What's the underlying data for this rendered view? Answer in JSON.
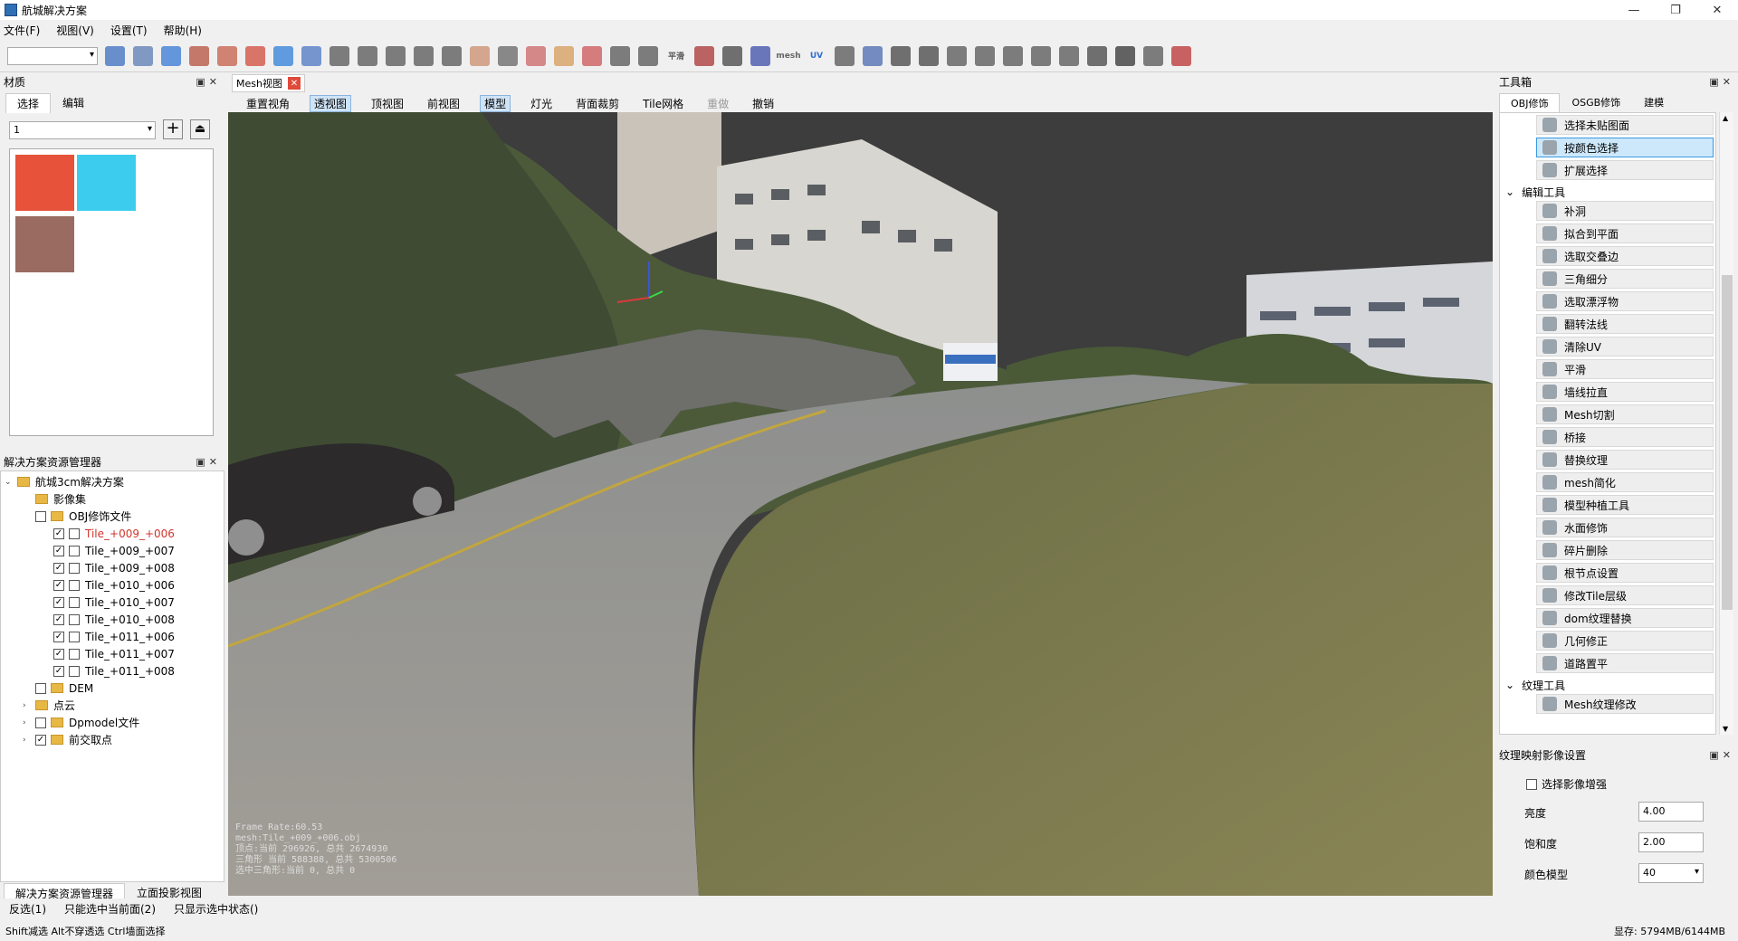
{
  "window": {
    "title": "航城解决方案"
  },
  "menu": [
    "文件(F)",
    "视图(V)",
    "设置(T)",
    "帮助(H)"
  ],
  "toolbar": {
    "icons": [
      {
        "name": "grid-icon",
        "color": "#3b6fc0",
        "glyph": ""
      },
      {
        "name": "layer-icon",
        "color": "#5b7cb3",
        "glyph": ""
      },
      {
        "name": "cylinder-blue-icon",
        "color": "#3478d4",
        "glyph": ""
      },
      {
        "name": "cylinder-red-icon",
        "color": "#b5503c",
        "glyph": ""
      },
      {
        "name": "diamond-icon",
        "color": "#c65f4a",
        "glyph": ""
      },
      {
        "name": "select-box-icon",
        "color": "#d24b3b",
        "glyph": ""
      },
      {
        "name": "magnifier-icon",
        "color": "#2f7fd8",
        "glyph": ""
      },
      {
        "name": "paint-select-icon",
        "color": "#4d77c4",
        "glyph": ""
      },
      {
        "name": "pointer-icon",
        "color": "#555",
        "glyph": ""
      },
      {
        "name": "brush-icon",
        "color": "#555",
        "glyph": ""
      },
      {
        "name": "arrow-select-icon",
        "color": "#555",
        "glyph": ""
      },
      {
        "name": "pen-icon",
        "color": "#555",
        "glyph": ""
      },
      {
        "name": "expand-select-icon",
        "color": "#555",
        "glyph": ""
      },
      {
        "name": "fill-hole-icon",
        "color": "#c98e6c",
        "glyph": ""
      },
      {
        "name": "triangle-icon",
        "color": "#666",
        "glyph": ""
      },
      {
        "name": "edge-icon",
        "color": "#c66",
        "glyph": ""
      },
      {
        "name": "subdivide-icon",
        "color": "#d79b5a",
        "glyph": ""
      },
      {
        "name": "floating-icon",
        "color": "#c55",
        "glyph": ""
      },
      {
        "name": "flip-icon",
        "color": "#555",
        "glyph": ""
      },
      {
        "name": "eraser-icon",
        "color": "#555",
        "glyph": ""
      },
      {
        "name": "smooth-icon",
        "color": "#555",
        "glyph": "平滑"
      },
      {
        "name": "wall-icon",
        "color": "#a33",
        "glyph": ""
      },
      {
        "name": "mesh-cut-icon",
        "color": "#444",
        "glyph": ""
      },
      {
        "name": "bridge-icon",
        "color": "#3c4fa8",
        "glyph": ""
      },
      {
        "name": "mesh-icon",
        "color": "#666",
        "glyph": "mesh"
      },
      {
        "name": "uv-icon",
        "color": "#2f6fcf",
        "glyph": "UV"
      },
      {
        "name": "texture-replace-icon",
        "color": "#555",
        "glyph": ""
      },
      {
        "name": "mesh-simplify-icon",
        "color": "#4a6ab0",
        "glyph": ""
      },
      {
        "name": "anchor-icon",
        "color": "#444",
        "glyph": ""
      },
      {
        "name": "hierarchy-icon",
        "color": "#444",
        "glyph": ""
      },
      {
        "name": "document-icon",
        "color": "#555",
        "glyph": ""
      },
      {
        "name": "dom-texture-icon",
        "color": "#555",
        "glyph": ""
      },
      {
        "name": "osgb-icon",
        "color": "#555",
        "glyph": ""
      },
      {
        "name": "tile-icon",
        "color": "#555",
        "glyph": ""
      },
      {
        "name": "road-icon",
        "color": "#555",
        "glyph": ""
      },
      {
        "name": "download-icon",
        "color": "#444",
        "glyph": ""
      },
      {
        "name": "model-icon",
        "color": "#333",
        "glyph": ""
      },
      {
        "name": "export-icon",
        "color": "#555",
        "glyph": ""
      },
      {
        "name": "close-red-icon",
        "color": "#b33",
        "glyph": ""
      }
    ]
  },
  "left_panel": {
    "title": "材质",
    "tabs": [
      "选择",
      "编辑"
    ],
    "combo_value": "1",
    "swatches": [
      "#e6533a",
      "#3ccdee",
      "#9a6b60"
    ]
  },
  "solution_panel": {
    "title": "解决方案资源管理器",
    "tree": [
      {
        "label": "航城3cm解决方案",
        "level": 0,
        "type": "folder",
        "check": null,
        "arrow": "⌄"
      },
      {
        "label": "影像集",
        "level": 1,
        "type": "folder",
        "check": null,
        "arrow": ""
      },
      {
        "label": "OBJ修饰文件",
        "level": 1,
        "type": "folder",
        "check": "unchecked",
        "arrow": ""
      },
      {
        "label": "Tile_+009_+006",
        "level": 2,
        "type": "file",
        "check": "checked",
        "arrow": "",
        "red": true
      },
      {
        "label": "Tile_+009_+007",
        "level": 2,
        "type": "file",
        "check": "checked",
        "arrow": ""
      },
      {
        "label": "Tile_+009_+008",
        "level": 2,
        "type": "file",
        "check": "checked",
        "arrow": ""
      },
      {
        "label": "Tile_+010_+006",
        "level": 2,
        "type": "file",
        "check": "checked",
        "arrow": ""
      },
      {
        "label": "Tile_+010_+007",
        "level": 2,
        "type": "file",
        "check": "checked",
        "arrow": ""
      },
      {
        "label": "Tile_+010_+008",
        "level": 2,
        "type": "file",
        "check": "checked",
        "arrow": ""
      },
      {
        "label": "Tile_+011_+006",
        "level": 2,
        "type": "file",
        "check": "checked",
        "arrow": ""
      },
      {
        "label": "Tile_+011_+007",
        "level": 2,
        "type": "file",
        "check": "checked",
        "arrow": ""
      },
      {
        "label": "Tile_+011_+008",
        "level": 2,
        "type": "file",
        "check": "checked",
        "arrow": ""
      },
      {
        "label": "DEM",
        "level": 1,
        "type": "folder",
        "check": "unchecked",
        "arrow": ""
      },
      {
        "label": "点云",
        "level": 1,
        "type": "folder",
        "check": null,
        "arrow": "›"
      },
      {
        "label": "Dpmodel文件",
        "level": 1,
        "type": "folder",
        "check": "unchecked",
        "arrow": "›"
      },
      {
        "label": "前交取点",
        "level": 1,
        "type": "folder",
        "check": "checked",
        "arrow": "›"
      }
    ],
    "bottom_tabs": [
      "解决方案资源管理器",
      "立面投影视图"
    ]
  },
  "doc_tab": "Mesh视图",
  "view_toolbar": [
    {
      "label": "重置视角",
      "state": "normal"
    },
    {
      "label": "透视图",
      "state": "selected"
    },
    {
      "label": "顶视图",
      "state": "normal"
    },
    {
      "label": "前视图",
      "state": "normal"
    },
    {
      "label": "模型",
      "state": "selected"
    },
    {
      "label": "灯光",
      "state": "normal"
    },
    {
      "label": "背面裁剪",
      "state": "normal"
    },
    {
      "label": "Tile网格",
      "state": "normal"
    },
    {
      "label": "重做",
      "state": "disabled"
    },
    {
      "label": "撤销",
      "state": "normal"
    }
  ],
  "hud": [
    "Frame Rate:60.53",
    "mesh:Tile_+009_+006.obj",
    "顶点:当前 296926, 总共 2674930",
    "三角形 当前 588388, 总共 5300506",
    "选中三角形:当前 0, 总共 0"
  ],
  "toolbox": {
    "title": "工具箱",
    "tabs": [
      "OBJ修饰",
      "OSGB修饰",
      "建模"
    ],
    "items": [
      {
        "label": "选择未贴图面",
        "kind": "item"
      },
      {
        "label": "按颜色选择",
        "kind": "item",
        "highlight": true
      },
      {
        "label": "扩展选择",
        "kind": "item"
      },
      {
        "label": "编辑工具",
        "kind": "group"
      },
      {
        "label": "补洞",
        "kind": "item"
      },
      {
        "label": "拟合到平面",
        "kind": "item"
      },
      {
        "label": "选取交叠边",
        "kind": "item"
      },
      {
        "label": "三角细分",
        "kind": "item"
      },
      {
        "label": "选取漂浮物",
        "kind": "item"
      },
      {
        "label": "翻转法线",
        "kind": "item"
      },
      {
        "label": "清除UV",
        "kind": "item"
      },
      {
        "label": "平滑",
        "kind": "item"
      },
      {
        "label": "墙线拉直",
        "kind": "item"
      },
      {
        "label": "Mesh切割",
        "kind": "item"
      },
      {
        "label": "桥接",
        "kind": "item"
      },
      {
        "label": "替换纹理",
        "kind": "item"
      },
      {
        "label": "mesh简化",
        "kind": "item"
      },
      {
        "label": "模型种植工具",
        "kind": "item"
      },
      {
        "label": "水面修饰",
        "kind": "item"
      },
      {
        "label": "碎片删除",
        "kind": "item"
      },
      {
        "label": "根节点设置",
        "kind": "item"
      },
      {
        "label": "修改Tile层级",
        "kind": "item"
      },
      {
        "label": "dom纹理替换",
        "kind": "item"
      },
      {
        "label": "几何修正",
        "kind": "item"
      },
      {
        "label": "道路置平",
        "kind": "item"
      },
      {
        "label": "纹理工具",
        "kind": "group"
      },
      {
        "label": "Mesh纹理修改",
        "kind": "item"
      }
    ]
  },
  "texture_panel": {
    "title": "纹理映射影像设置",
    "checkbox_label": "选择影像增强",
    "brightness_label": "亮度",
    "brightness_value": "4.00",
    "saturation_label": "饱和度",
    "saturation_value": "2.00",
    "color_model_label": "颜色模型",
    "color_model_value": "40"
  },
  "status1": [
    "反选(1)",
    "只能选中当前面(2)",
    "只显示选中状态()"
  ],
  "status2": {
    "left": "Shift减选  Alt不穿透选  Ctrl墙面选择",
    "right": "显存: 5794MB/6144MB"
  }
}
